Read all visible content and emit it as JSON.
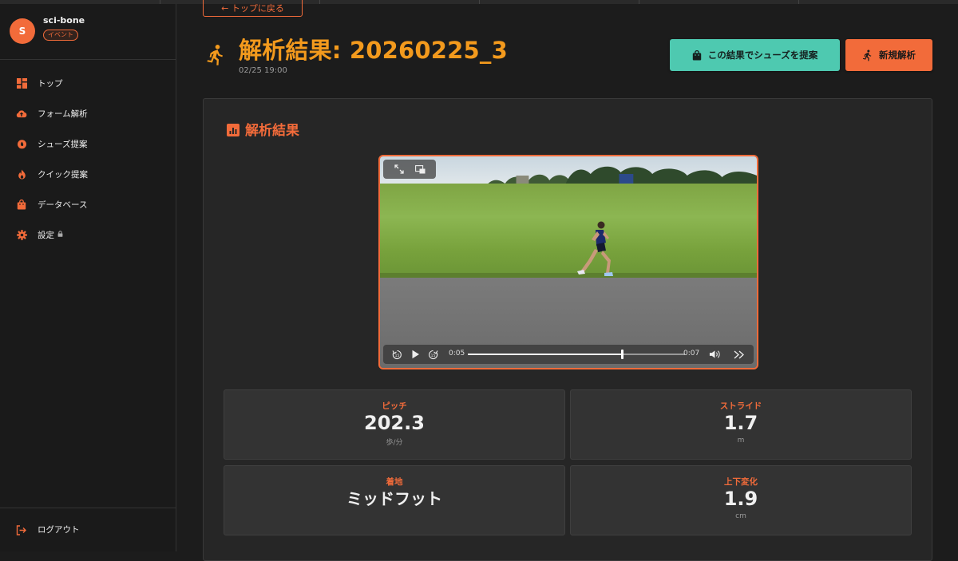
{
  "sidebar": {
    "avatar_initial": "S",
    "username": "sci-bone",
    "badge": "イベント",
    "items": [
      {
        "label": "トップ",
        "icon": "dashboard-icon"
      },
      {
        "label": "フォーム解析",
        "icon": "cloud-upload-icon"
      },
      {
        "label": "シューズ提案",
        "icon": "sparkle-icon"
      },
      {
        "label": "クイック提案",
        "icon": "flame-icon"
      },
      {
        "label": "データベース",
        "icon": "shopping-bag-icon"
      },
      {
        "label": "設定",
        "icon": "gear-icon",
        "locked": true
      }
    ],
    "logout": "ログアウト"
  },
  "header": {
    "back_label": "← トップに戻る",
    "title": "解析結果: 20260225_3",
    "date": "02/25 19:00",
    "suggest_button": "この結果でシューズを提案",
    "new_analysis_button": "新規解析"
  },
  "result": {
    "section_title": "解析結果",
    "video": {
      "current_time": "0:05",
      "duration": "0:07",
      "progress": 0.71
    },
    "metrics": [
      {
        "label": "ピッチ",
        "value": "202.3",
        "unit": "歩/分"
      },
      {
        "label": "ストライド",
        "value": "1.7",
        "unit": "m"
      },
      {
        "label": "着地",
        "value": "ミッドフット",
        "unit": ""
      },
      {
        "label": "上下変化",
        "value": "1.9",
        "unit": "cm"
      }
    ]
  },
  "colors": {
    "accent": "#f26b3a",
    "title": "#f39a1d",
    "teal": "#4ec9b0",
    "background": "#1c1c1c"
  }
}
